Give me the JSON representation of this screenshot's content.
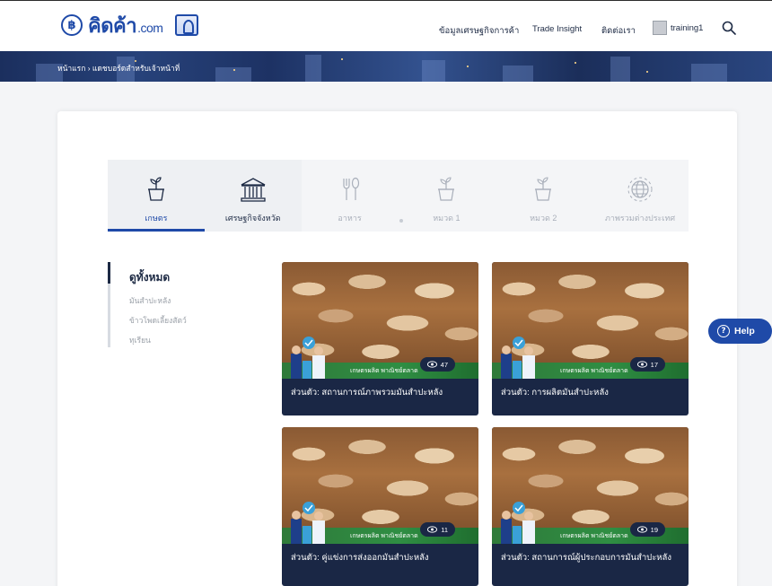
{
  "header": {
    "logo_text": "คิดค้า",
    "logo_domain": ".com",
    "nav": [
      {
        "label": "ข้อมูลเศรษฐกิจการค้า"
      },
      {
        "label": "Trade Insight"
      },
      {
        "label": "ติดต่อเรา"
      }
    ],
    "user_name": "training1"
  },
  "breadcrumb": "หน้าแรก › แดชบอร์ดสำหรับเจ้าหน้าที่",
  "tabs": [
    {
      "label": "เกษตร",
      "icon": "plant-pot-icon"
    },
    {
      "label": "เศรษฐกิจจังหวัด",
      "icon": "government-building-icon"
    },
    {
      "label": "อาหาร",
      "icon": "fork-spoon-icon"
    },
    {
      "label": "หมวด 1",
      "icon": "plant-pot-icon"
    },
    {
      "label": "หมวด 2",
      "icon": "plant-pot-icon"
    },
    {
      "label": "ภาพรวมต่างประเทศ",
      "icon": "globe-icon"
    }
  ],
  "sidebar": {
    "title": "ดูทั้งหมด",
    "items": [
      {
        "label": "มันสำปะหลัง"
      },
      {
        "label": "ข้าวโพดเลี้ยงสัตว์"
      },
      {
        "label": "ทุเรียน"
      }
    ]
  },
  "cards": [
    {
      "title": "ส่วนตัว: สถานการณ์ภาพรวมมันสำปะหลัง",
      "views": "47",
      "caption": "เกษตรผลิต พาณิชย์ตลาด"
    },
    {
      "title": "ส่วนตัว: การผลิตมันสำปะหลัง",
      "views": "17",
      "caption": "เกษตรผลิต พาณิชย์ตลาด"
    },
    {
      "title": "ส่วนตัว: คู่แข่งการส่งออกมันสำปะหลัง",
      "views": "11",
      "caption": "เกษตรผลิต พาณิชย์ตลาด"
    },
    {
      "title": "ส่วนตัว: สถานการณ์ผู้ประกอบการมันสำปะหลัง",
      "views": "19",
      "caption": "เกษตรผลิต พาณิชย์ตลาด"
    }
  ],
  "help": {
    "label": "Help"
  },
  "colors": {
    "brand": "#1f4aa8",
    "navy": "#1a2745",
    "strip": "#2f8e43"
  }
}
